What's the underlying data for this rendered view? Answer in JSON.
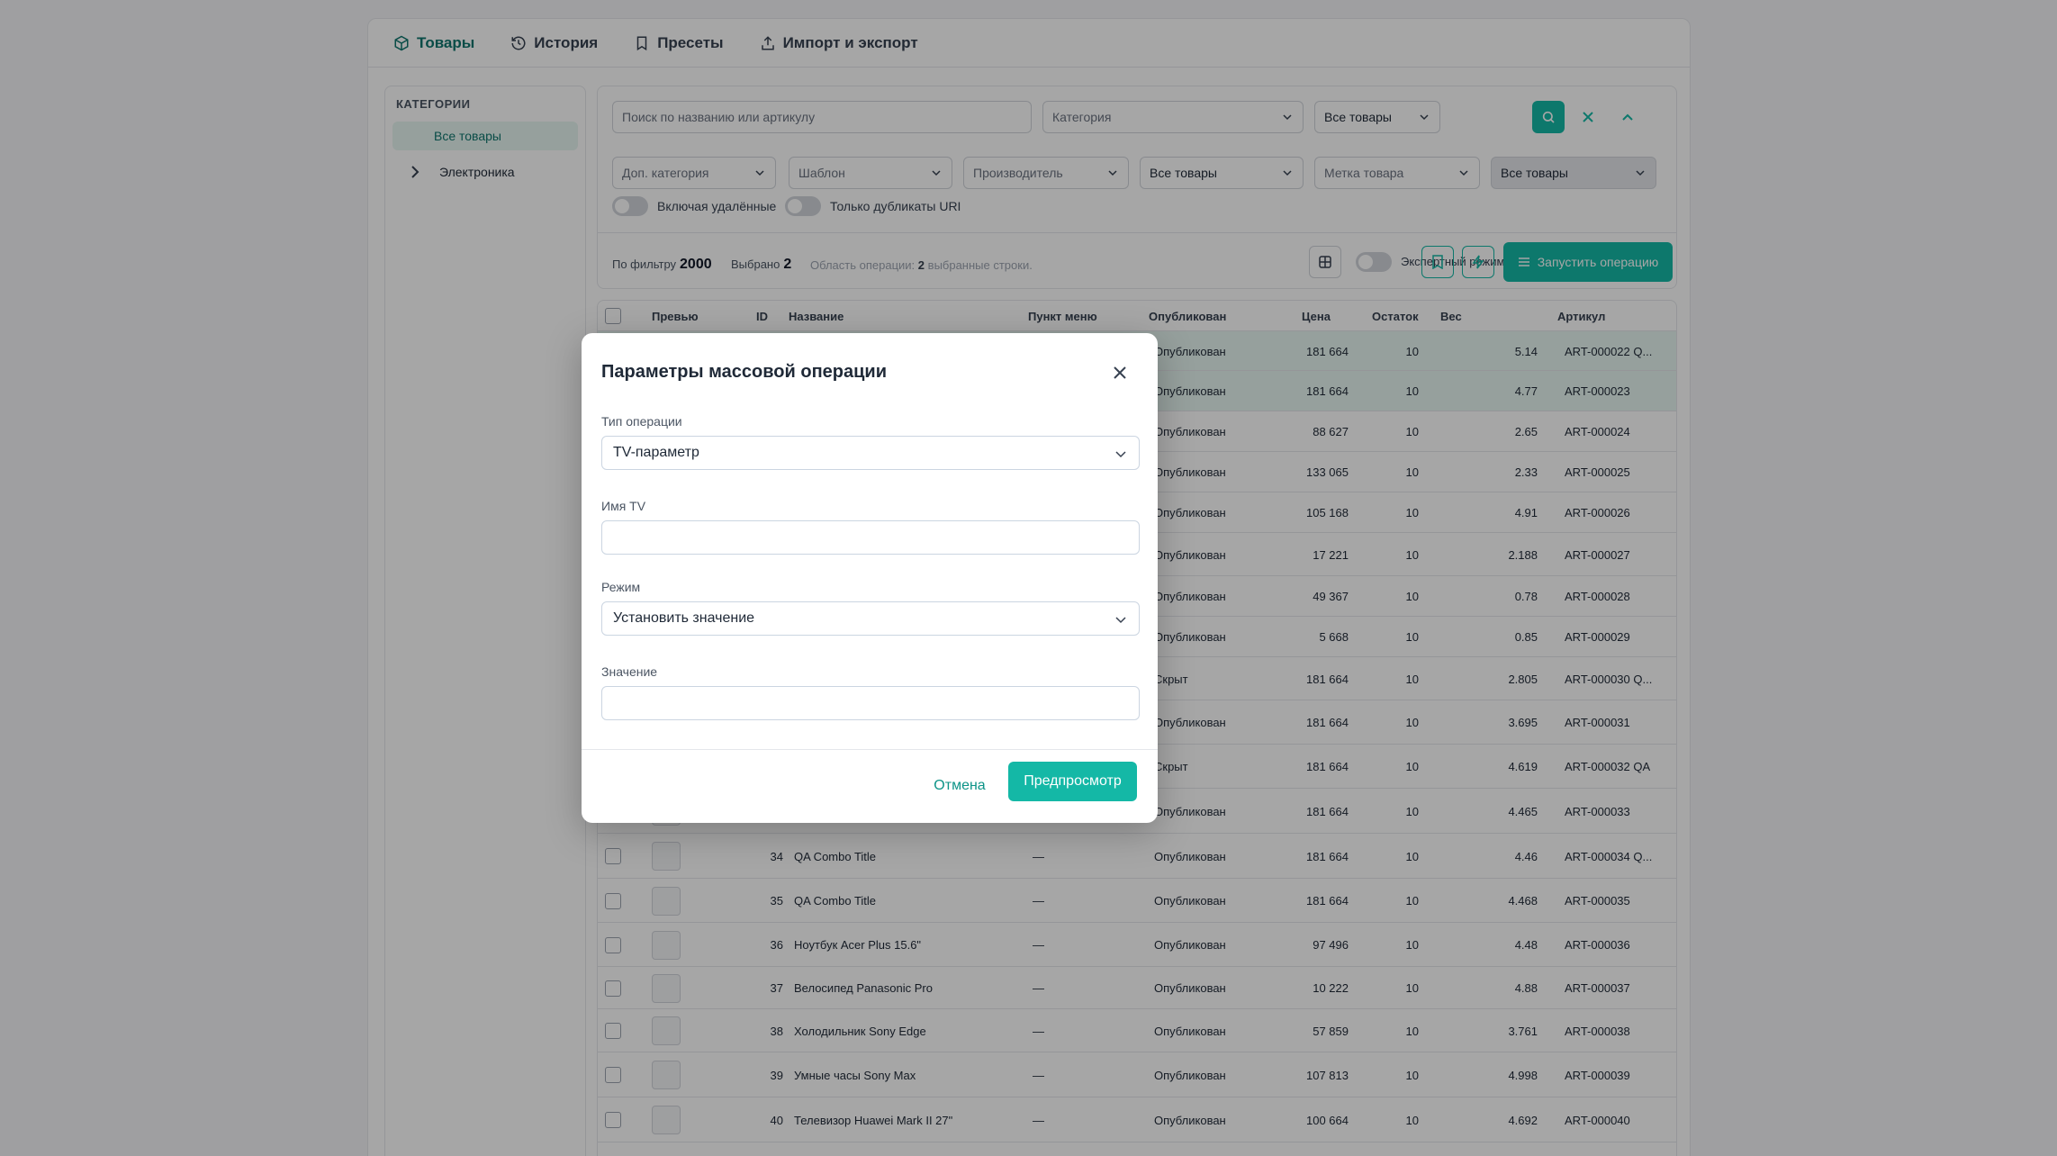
{
  "nav": {
    "tabs": [
      "Товары",
      "История",
      "Пресеты",
      "Импорт и экспорт"
    ]
  },
  "sidebar": {
    "caption": "КАТЕГОРИИ",
    "all": "Все товары",
    "electronics": "Электроника"
  },
  "filters": {
    "search_placeholder": "Поиск по названию или артикулу",
    "category": "Категория",
    "all_goods_1": "Все товары",
    "extra_category": "Доп. категория",
    "template": "Шаблон",
    "manufacturer": "Производитель",
    "all_goods_2": "Все товары",
    "tag": "Метка товара",
    "all_goods_3": "Все товары",
    "toggle_deleted": "Включая удалённые",
    "toggle_dupes": "Только дубликаты URI"
  },
  "stats": {
    "by_filter_label": "По фильтру",
    "by_filter_value": "2000",
    "selected_label": "Выбрано",
    "selected_value": "2",
    "scope_prefix": "Область операции:",
    "scope_count": "2",
    "scope_suffix": "выбранные строки.",
    "expert_mode": "Экспертный режим",
    "run_operation": "Запустить операцию"
  },
  "table": {
    "headers": [
      "Превью",
      "ID",
      "Название",
      "Пункт меню",
      "Опубликован",
      "Цена",
      "Остаток",
      "Вес",
      "Артикул"
    ],
    "rows": [
      {
        "id": "",
        "name": "",
        "menu": "",
        "status": "Опубликован",
        "price": "181 664",
        "stock": "10",
        "weight": "5.14",
        "sku": "ART-000022 Q...",
        "sel": true
      },
      {
        "id": "",
        "name": "",
        "menu": "",
        "status": "Опубликован",
        "price": "181 664",
        "stock": "10",
        "weight": "4.77",
        "sku": "ART-000023",
        "sel": true
      },
      {
        "id": "",
        "name": "",
        "menu": "",
        "status": "Опубликован",
        "price": "88 627",
        "stock": "10",
        "weight": "2.65",
        "sku": "ART-000024"
      },
      {
        "id": "",
        "name": "",
        "menu": "",
        "status": "Опубликован",
        "price": "133 065",
        "stock": "10",
        "weight": "2.33",
        "sku": "ART-000025"
      },
      {
        "id": "",
        "name": "",
        "menu": "",
        "status": "Опубликован",
        "price": "105 168",
        "stock": "10",
        "weight": "4.91",
        "sku": "ART-000026"
      },
      {
        "id": "",
        "name": "",
        "menu": "",
        "status": "Опубликован",
        "price": "17 221",
        "stock": "10",
        "weight": "2.188",
        "sku": "ART-000027"
      },
      {
        "id": "",
        "name": "",
        "menu": "",
        "status": "Опубликован",
        "price": "49 367",
        "stock": "10",
        "weight": "0.78",
        "sku": "ART-000028"
      },
      {
        "id": "",
        "name": "",
        "menu": "",
        "status": "Опубликован",
        "price": "5 668",
        "stock": "10",
        "weight": "0.85",
        "sku": "ART-000029"
      },
      {
        "id": "",
        "name": "",
        "menu": "",
        "status": "Скрыт",
        "price": "181 664",
        "stock": "10",
        "weight": "2.805",
        "sku": "ART-000030 Q..."
      },
      {
        "id": "",
        "name": "",
        "menu": "",
        "status": "Опубликован",
        "price": "181 664",
        "stock": "10",
        "weight": "3.695",
        "sku": "ART-000031"
      },
      {
        "id": "",
        "name": "",
        "menu": "",
        "status": "Скрыт",
        "price": "181 664",
        "stock": "10",
        "weight": "4.619",
        "sku": "ART-000032 QA"
      },
      {
        "id": "",
        "name": "",
        "menu": "",
        "status": "Опубликован",
        "price": "181 664",
        "stock": "10",
        "weight": "4.465",
        "sku": "ART-000033"
      },
      {
        "id": "34",
        "name": "QA Combo Title",
        "menu": "—",
        "status": "Опубликован",
        "price": "181 664",
        "stock": "10",
        "weight": "4.46",
        "sku": "ART-000034 Q..."
      },
      {
        "id": "35",
        "name": "QA Combo Title",
        "menu": "—",
        "status": "Опубликован",
        "price": "181 664",
        "stock": "10",
        "weight": "4.468",
        "sku": "ART-000035"
      },
      {
        "id": "36",
        "name": "Ноутбук Acer Plus 15.6\"",
        "menu": "—",
        "status": "Опубликован",
        "price": "97 496",
        "stock": "10",
        "weight": "4.48",
        "sku": "ART-000036"
      },
      {
        "id": "37",
        "name": "Велосипед Panasonic Pro",
        "menu": "—",
        "status": "Опубликован",
        "price": "10 222",
        "stock": "10",
        "weight": "4.88",
        "sku": "ART-000037"
      },
      {
        "id": "38",
        "name": "Холодильник Sony Edge",
        "menu": "—",
        "status": "Опубликован",
        "price": "57 859",
        "stock": "10",
        "weight": "3.761",
        "sku": "ART-000038"
      },
      {
        "id": "39",
        "name": "Умные часы Sony Max",
        "menu": "—",
        "status": "Опубликован",
        "price": "107 813",
        "stock": "10",
        "weight": "4.998",
        "sku": "ART-000039"
      },
      {
        "id": "40",
        "name": "Телевизор Huawei Mark II 27\"",
        "menu": "—",
        "status": "Опубликован",
        "price": "100 664",
        "stock": "10",
        "weight": "4.692",
        "sku": "ART-000040"
      }
    ]
  },
  "modal": {
    "title": "Параметры массовой операции",
    "op_type_label": "Тип операции",
    "op_type_value": "TV-параметр",
    "tv_name_label": "Имя TV",
    "tv_name_value": "",
    "mode_label": "Режим",
    "mode_value": "Установить значение",
    "value_label": "Значение",
    "value_value": "",
    "cancel": "Отмена",
    "preview": "Предпросмотр"
  },
  "colors": {
    "accent": "#14b8a6",
    "accent_dark": "#0f766e"
  }
}
